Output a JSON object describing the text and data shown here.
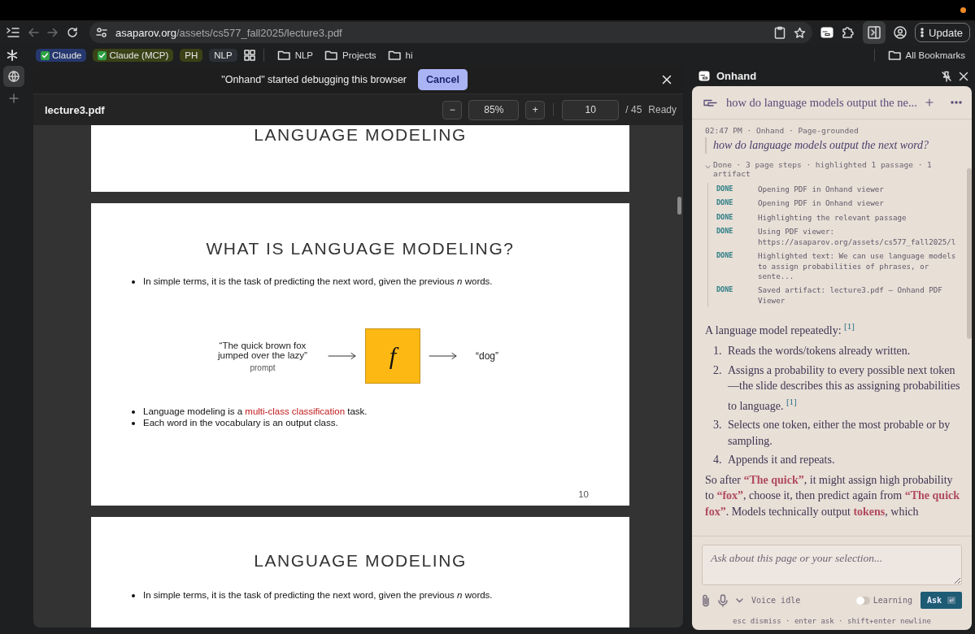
{
  "toolbar": {
    "url_host": "asaparov.org",
    "url_path": "/assets/cs577_fall2025/lecture3.pdf",
    "update_label": "Update"
  },
  "bookmarks": [
    {
      "label": "Claude",
      "kind": "tag",
      "checked": true,
      "color": "#26386e"
    },
    {
      "label": "Claude (MCP)",
      "kind": "tag",
      "checked": true,
      "color": "#3a4217"
    },
    {
      "label": "PH",
      "kind": "tag",
      "checked": false,
      "color": "#3c4216"
    },
    {
      "label": "NLP",
      "kind": "tag",
      "checked": false,
      "color": "#2d3036"
    },
    {
      "kind": "apps"
    },
    {
      "label": "NLP",
      "kind": "folder"
    },
    {
      "label": "Projects",
      "kind": "folder"
    },
    {
      "label": "hi",
      "kind": "folder"
    }
  ],
  "all_bookmarks": "All Bookmarks",
  "debug_banner": {
    "message": "\"Onhand\" started debugging this browser",
    "cancel_label": "Cancel"
  },
  "pdf_viewer": {
    "file_name": "lecture3.pdf",
    "zoom_out": "−",
    "zoom": "85%",
    "zoom_in": "+",
    "page": "10",
    "page_total": "/ 45",
    "status": "Ready",
    "pages": [
      {
        "kind": "tail",
        "title": "LANGUAGE MODELING"
      },
      {
        "kind": "slide",
        "title": "WHAT IS LANGUAGE MODELING?",
        "bullets": [
          "In simple terms, it is the task of predicting the next word, given the previous *n* words."
        ],
        "diagram": {
          "prompt": "“The quick brown fox jumped over the lazy”",
          "prompt_caption": "prompt",
          "function_symbol": "f",
          "output": "“dog”"
        },
        "bullets_after": [
          [
            {
              "text": "Language modeling is a ",
              "highlight": false
            },
            {
              "text": "multi-class classification",
              "highlight": true
            },
            {
              "text": " task.",
              "highlight": false
            }
          ],
          [
            {
              "text": "Each word in the vocabulary is an output class.",
              "highlight": false
            }
          ]
        ],
        "page_number": "10"
      },
      {
        "kind": "head",
        "title": "LANGUAGE MODELING",
        "bullets": [
          "In simple terms, it is the task of predicting the next word, given the previous *n* words."
        ]
      }
    ]
  },
  "assistant": {
    "panel_title": "Onhand",
    "thread_title": "how do language models output the ne...",
    "meta": "02:47 PM · Onhand · Page-grounded",
    "question": "how do language models output the next word?",
    "summary": {
      "text": "Done · 3 page steps · highlighted 1 passage · 1 artifact",
      "expanded": true
    },
    "steps": [
      {
        "status": "DONE",
        "text": "Opening PDF in Onhand viewer"
      },
      {
        "status": "DONE",
        "text": "Opening PDF in Onhand viewer"
      },
      {
        "status": "DONE",
        "text": "Highlighting the relevant passage"
      },
      {
        "status": "DONE",
        "text": "Using PDF viewer: https://asaparov.org/assets/cs577_fall2025/l"
      },
      {
        "status": "DONE",
        "text": "Highlighted text: We can use language models to assign probabilities of phrases, or sente..."
      },
      {
        "status": "DONE",
        "text": "Saved artifact: lecture3.pdf — Onhand PDF Viewer"
      }
    ],
    "answer_intro": "A language model repeatedly: $^{[1]}$",
    "answer_steps": [
      {
        "number": "1.",
        "text": "Reads the words/tokens already written."
      },
      {
        "number": "2.",
        "text": "Assigns a probability to every possible next token—the slide describes this as assigning probabilities to language. $^{[1]}$"
      },
      {
        "number": "3.",
        "text": "Selects one token, either the most probable or by sampling."
      },
      {
        "number": "4.",
        "text": "Appends it and repeats."
      }
    ],
    "answer_more": "So after **“The quick”**, it might assign high probability to **“fox”**, choose it, then predict again from **“The quick fox”**. Models technically output **tokens**, which",
    "composer": {
      "placeholder": "Ask about this page or your selection...",
      "voice_status": "Voice idle",
      "learning": {
        "label": "Learning",
        "on": false
      },
      "ask_label": "Ask",
      "hint": "esc dismiss · enter ask · shift+enter newline"
    }
  }
}
